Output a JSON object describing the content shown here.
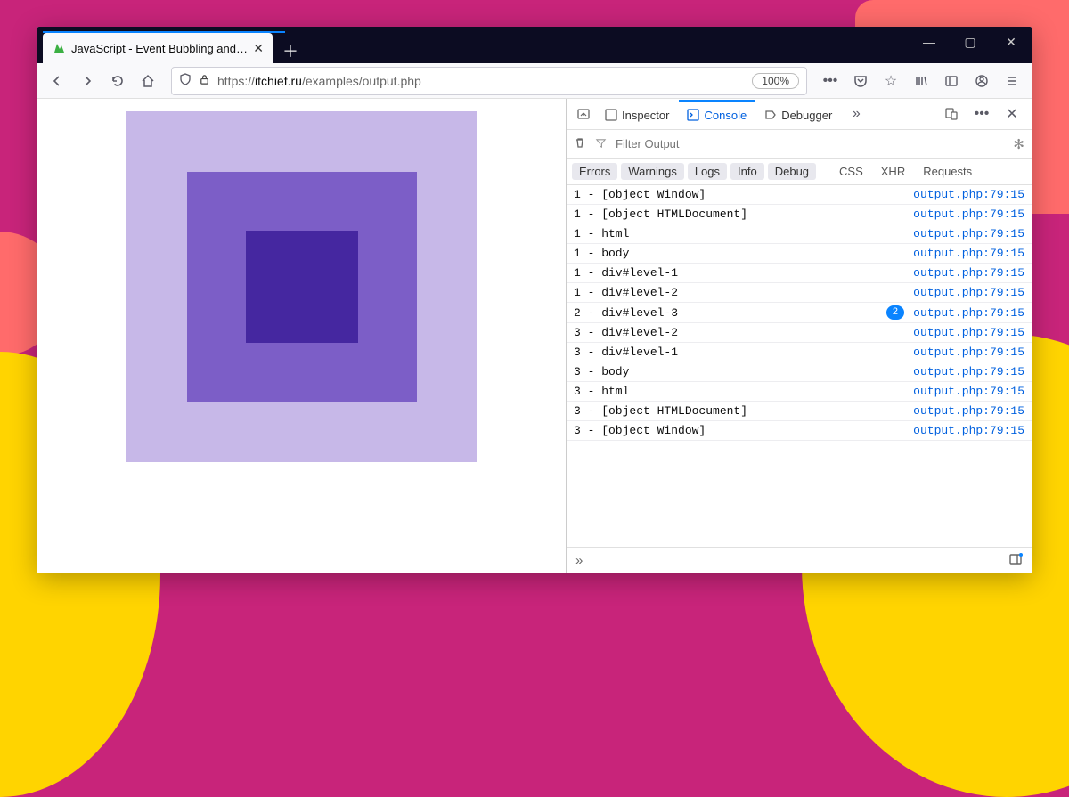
{
  "tab": {
    "title": "JavaScript - Event Bubbling and Capturing"
  },
  "url": {
    "protocol": "https://",
    "domain": "itchief.ru",
    "path": "/examples/output.php"
  },
  "zoom": "100%",
  "devtools": {
    "tabs": {
      "inspector": "Inspector",
      "console": "Console",
      "debugger": "Debugger"
    },
    "filter_placeholder": "Filter Output",
    "categories": {
      "errors": "Errors",
      "warnings": "Warnings",
      "logs": "Logs",
      "info": "Info",
      "debug": "Debug",
      "css": "CSS",
      "xhr": "XHR",
      "requests": "Requests"
    },
    "log_link": "output.php:79:15",
    "logs": [
      {
        "msg": "1 - [object Window]"
      },
      {
        "msg": "1 - [object HTMLDocument]"
      },
      {
        "msg": "1 - html"
      },
      {
        "msg": "1 - body"
      },
      {
        "msg": "1 - div#level-1"
      },
      {
        "msg": "1 - div#level-2"
      },
      {
        "msg": "2 - div#level-3",
        "badge": "2"
      },
      {
        "msg": "3 - div#level-2"
      },
      {
        "msg": "3 - div#level-1"
      },
      {
        "msg": "3 - body"
      },
      {
        "msg": "3 - html"
      },
      {
        "msg": "3 - [object HTMLDocument]"
      },
      {
        "msg": "3 - [object Window]"
      }
    ]
  }
}
